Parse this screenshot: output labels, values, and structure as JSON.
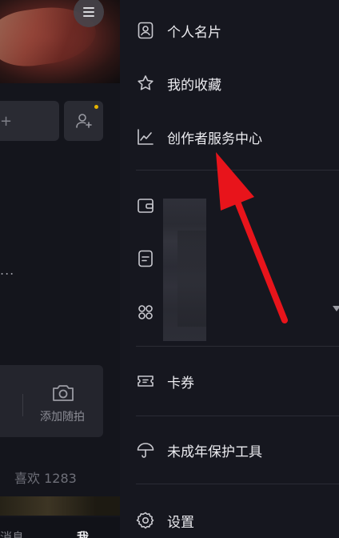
{
  "left_panel": {
    "add_photo_label": "添加随拍",
    "likes_label": "喜欢 1283",
    "bottom_nav": {
      "messages_label": "消息",
      "me_label": "我"
    },
    "plus_glyph": "+",
    "ellipsis": "..."
  },
  "drawer": {
    "items": [
      {
        "label": "个人名片",
        "icon": "id-card-icon"
      },
      {
        "label": "我的收藏",
        "icon": "star-icon"
      },
      {
        "label": "创作者服务中心",
        "icon": "line-chart-icon"
      },
      {
        "label": "卡券",
        "icon": "ticket-icon"
      },
      {
        "label": "未成年保护工具",
        "icon": "umbrella-icon"
      },
      {
        "label": "设置",
        "icon": "gear-icon"
      }
    ],
    "icon_only_rows": [
      "wallet-icon",
      "document-icon",
      "grid-apps-icon"
    ]
  },
  "annotation": {
    "arrow_color": "#e8141b"
  },
  "colors": {
    "drawer_bg": "#16171f",
    "text": "#ececf0",
    "accent_dot": "#e6b400"
  }
}
